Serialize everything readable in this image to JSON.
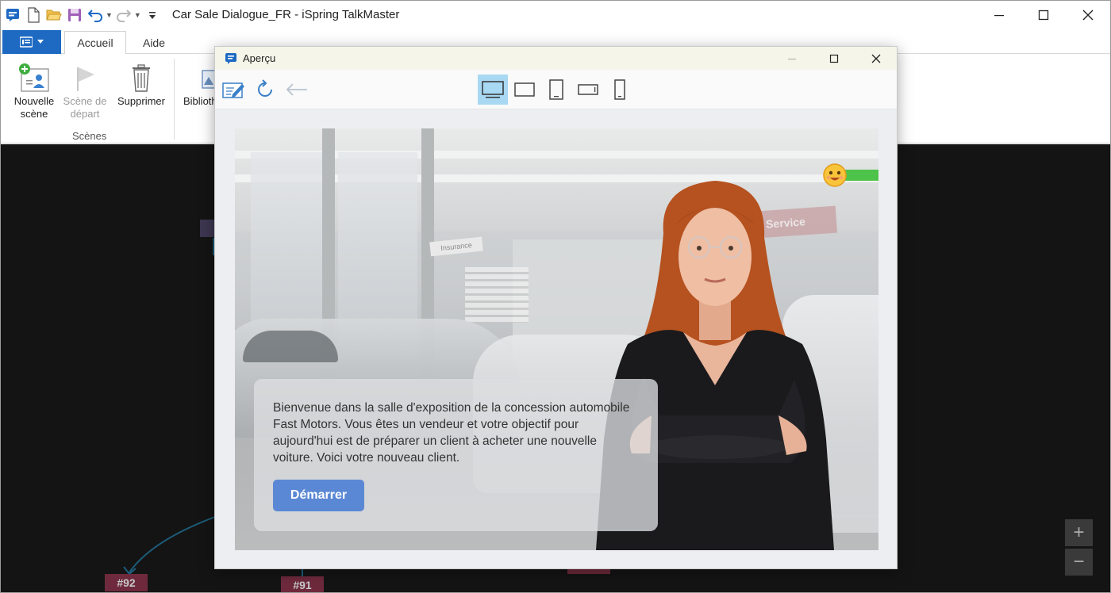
{
  "window": {
    "title": "Car Sale Dialogue_FR - iSpring TalkMaster"
  },
  "ribbon": {
    "tabs": [
      {
        "label": "Accueil",
        "active": true
      },
      {
        "label": "Aide",
        "active": false
      }
    ],
    "buttons": {
      "new_scene": {
        "label_line1": "Nouvelle",
        "label_line2": "scène"
      },
      "start_scene": {
        "label_line1": "Scène de",
        "label_line2": "départ",
        "disabled": true
      },
      "delete": {
        "label": "Supprimer"
      },
      "library": {
        "label": "Biblioth"
      }
    },
    "group_label": "Scènes"
  },
  "canvas": {
    "nodes": [
      "#92",
      "#91"
    ]
  },
  "preview": {
    "title": "Aperçu",
    "device_modes": [
      "desktop",
      "tablet-landscape",
      "tablet-portrait",
      "phone-landscape",
      "phone-portrait"
    ],
    "selected_mode": "desktop",
    "scene": {
      "sign_text": "Service",
      "sign2_text": "Insurance",
      "mood": "happy",
      "message": "Bienvenue dans la salle d'exposition de la concession automobile Fast Motors. Vous êtes un vendeur et votre objectif pour aujourd'hui est de préparer un client à acheter une nouvelle voiture. Voici votre nouveau client.",
      "start_button": "Démarrer"
    }
  },
  "colors": {
    "accent": "#1e6ac3",
    "start_button": "#5b88d4",
    "mood_bar": "#4dc34a",
    "canvas": "#141414",
    "node_tag": "#6e2a3c"
  }
}
